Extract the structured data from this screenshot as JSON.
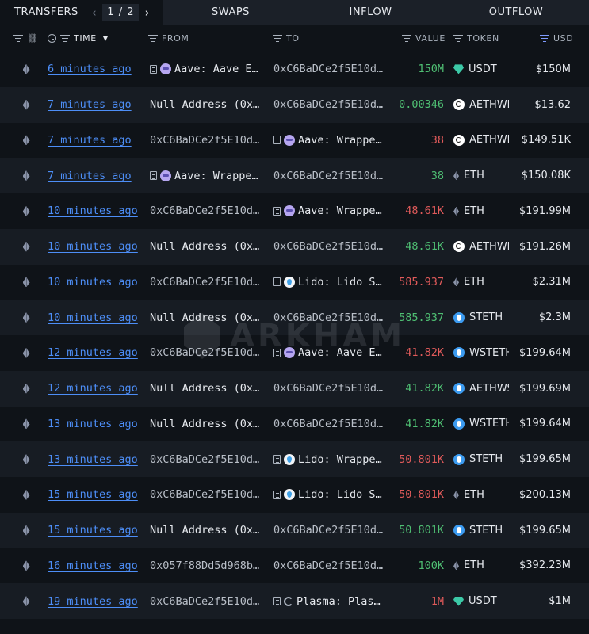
{
  "tabs": {
    "transfers": "TRANSFERS",
    "page_indicator": "1 / 2",
    "swaps": "SWAPS",
    "inflow": "INFLOW",
    "outflow": "OUTFLOW"
  },
  "columns": {
    "time": "TIME",
    "from": "FROM",
    "to": "TO",
    "value": "VALUE",
    "token": "TOKEN",
    "usd": "USD"
  },
  "watermark": "ARKHAM",
  "rows": [
    {
      "time": "6 minutes ago",
      "from": "Aave: Aave E…",
      "from_icon": "aave",
      "to": "0xC6BaDCe2f5E10d…",
      "to_icon": "",
      "value": "150M",
      "value_color": "pos",
      "token": "USDT",
      "token_icon": "usdt",
      "usd": "$150M"
    },
    {
      "time": "7 minutes ago",
      "from": "Null Address (0x…",
      "from_icon": "",
      "to": "0xC6BaDCe2f5E10d…",
      "to_icon": "",
      "value": "0.00346",
      "value_color": "pos",
      "token": "AETHWE",
      "token_icon": "aeth",
      "usd": "$13.62"
    },
    {
      "time": "7 minutes ago",
      "from": "0xC6BaDCe2f5E10d…",
      "from_icon": "",
      "to": "Aave: Wrappe…",
      "to_icon": "aave",
      "value": "38",
      "value_color": "neg",
      "token": "AETHWE",
      "token_icon": "aeth",
      "usd": "$149.51K"
    },
    {
      "time": "7 minutes ago",
      "from": "Aave: Wrappe…",
      "from_icon": "aave",
      "to": "0xC6BaDCe2f5E10d…",
      "to_icon": "",
      "value": "38",
      "value_color": "pos",
      "token": "ETH",
      "token_icon": "eth",
      "usd": "$150.08K"
    },
    {
      "time": "10 minutes ago",
      "from": "0xC6BaDCe2f5E10d…",
      "from_icon": "",
      "to": "Aave: Wrappe…",
      "to_icon": "aave",
      "value": "48.61K",
      "value_color": "neg",
      "token": "ETH",
      "token_icon": "eth",
      "usd": "$191.99M"
    },
    {
      "time": "10 minutes ago",
      "from": "Null Address (0x…",
      "from_icon": "",
      "to": "0xC6BaDCe2f5E10d…",
      "to_icon": "",
      "value": "48.61K",
      "value_color": "pos",
      "token": "AETHWE",
      "token_icon": "aeth",
      "usd": "$191.26M"
    },
    {
      "time": "10 minutes ago",
      "from": "0xC6BaDCe2f5E10d…",
      "from_icon": "",
      "to": "Lido: Lido S…",
      "to_icon": "lido",
      "value": "585.937",
      "value_color": "neg",
      "token": "ETH",
      "token_icon": "eth",
      "usd": "$2.31M"
    },
    {
      "time": "10 minutes ago",
      "from": "Null Address (0x…",
      "from_icon": "",
      "to": "0xC6BaDCe2f5E10d…",
      "to_icon": "",
      "value": "585.937",
      "value_color": "pos",
      "token": "STETH",
      "token_icon": "steth",
      "usd": "$2.3M"
    },
    {
      "time": "12 minutes ago",
      "from": "0xC6BaDCe2f5E10d…",
      "from_icon": "",
      "to": "Aave: Aave E…",
      "to_icon": "aave",
      "value": "41.82K",
      "value_color": "neg",
      "token": "WSTETH",
      "token_icon": "steth",
      "usd": "$199.64M"
    },
    {
      "time": "12 minutes ago",
      "from": "Null Address (0x…",
      "from_icon": "",
      "to": "0xC6BaDCe2f5E10d…",
      "to_icon": "",
      "value": "41.82K",
      "value_color": "pos",
      "token": "AETHWS",
      "token_icon": "steth",
      "usd": "$199.69M"
    },
    {
      "time": "13 minutes ago",
      "from": "Null Address (0x…",
      "from_icon": "",
      "to": "0xC6BaDCe2f5E10d…",
      "to_icon": "",
      "value": "41.82K",
      "value_color": "pos",
      "token": "WSTETH",
      "token_icon": "steth",
      "usd": "$199.64M"
    },
    {
      "time": "13 minutes ago",
      "from": "0xC6BaDCe2f5E10d…",
      "from_icon": "",
      "to": "Lido: Wrappe…",
      "to_icon": "lido",
      "value": "50.801K",
      "value_color": "neg",
      "token": "STETH",
      "token_icon": "steth",
      "usd": "$199.65M"
    },
    {
      "time": "15 minutes ago",
      "from": "0xC6BaDCe2f5E10d…",
      "from_icon": "",
      "to": "Lido: Lido S…",
      "to_icon": "lido",
      "value": "50.801K",
      "value_color": "neg",
      "token": "ETH",
      "token_icon": "eth",
      "usd": "$200.13M"
    },
    {
      "time": "15 minutes ago",
      "from": "Null Address (0x…",
      "from_icon": "",
      "to": "0xC6BaDCe2f5E10d…",
      "to_icon": "",
      "value": "50.801K",
      "value_color": "pos",
      "token": "STETH",
      "token_icon": "steth",
      "usd": "$199.65M"
    },
    {
      "time": "16 minutes ago",
      "from": "0x057f88Dd5d968b…",
      "from_icon": "",
      "to": "0xC6BaDCe2f5E10d…",
      "to_icon": "",
      "value": "100K",
      "value_color": "pos",
      "token": "ETH",
      "token_icon": "eth",
      "usd": "$392.23M"
    },
    {
      "time": "19 minutes ago",
      "from": "0xC6BaDCe2f5E10d…",
      "from_icon": "",
      "to": "Plasma: Plas…",
      "to_icon": "plasma",
      "value": "1M",
      "value_color": "neg",
      "token": "USDT",
      "token_icon": "usdt",
      "usd": "$1M"
    }
  ]
}
